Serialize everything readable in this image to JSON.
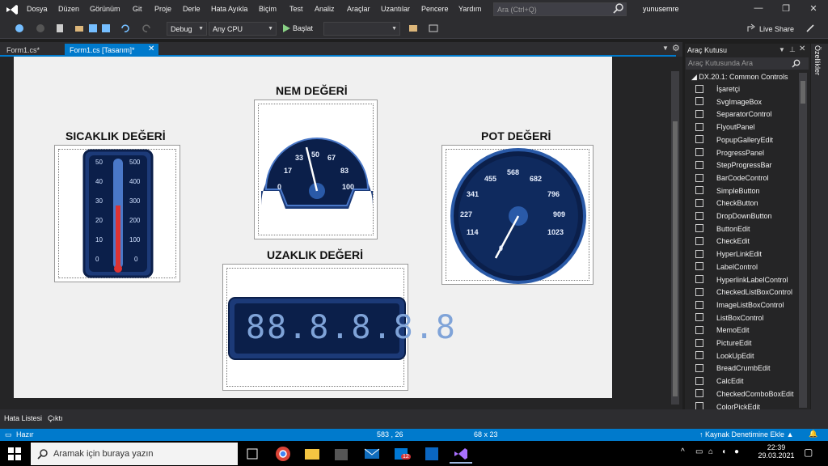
{
  "menu": [
    "Dosya",
    "Düzen",
    "Görünüm",
    "Git",
    "Proje",
    "Derle",
    "Hata Ayıkla",
    "Biçim",
    "Test",
    "Analiz",
    "Araçlar",
    "Uzantılar",
    "Pencere",
    "Yardım"
  ],
  "search": {
    "placeholder": "Ara (Ctrl+Q)"
  },
  "user": "yunusemre",
  "window_controls": {
    "minimize": "—",
    "restore": "❐",
    "close": "✕"
  },
  "toolbar": {
    "config": "Debug",
    "platform": "Any CPU",
    "start": "Başlat",
    "live_share": "Live Share"
  },
  "tabs": [
    {
      "label": "Form1.cs*"
    },
    {
      "label": "Form1.cs [Tasarım]*"
    }
  ],
  "designer": {
    "temp_label": "SICAKLIK DEĞERİ",
    "hum_label": "NEM DEĞERİ",
    "pot_label": "POT DEĞERİ",
    "dist_label": "UZAKLIK DEĞERİ",
    "thermo_left": [
      "50",
      "40",
      "30",
      "20",
      "10",
      "0"
    ],
    "thermo_right": [
      "500",
      "400",
      "300",
      "200",
      "100",
      "0"
    ],
    "hum_ticks": [
      "0",
      "17",
      "33",
      "50",
      "67",
      "83",
      "100"
    ],
    "pot_ticks": [
      "0",
      "114",
      "227",
      "341",
      "455",
      "568",
      "682",
      "796",
      "909",
      "1023"
    ],
    "digits": "88.8.8.8.8"
  },
  "toolbox": {
    "title": "Araç Kutusu",
    "search_placeholder": "Araç Kutusunda Ara",
    "group": "DX.20.1: Common Controls",
    "items": [
      "İşaretçi",
      "SvgImageBox",
      "SeparatorControl",
      "FlyoutPanel",
      "PopupGalleryEdit",
      "ProgressPanel",
      "StepProgressBar",
      "BarCodeControl",
      "SimpleButton",
      "CheckButton",
      "DropDownButton",
      "ButtonEdit",
      "CheckEdit",
      "HyperLinkEdit",
      "LabelControl",
      "HyperlinkLabelControl",
      "CheckedListBoxControl",
      "ImageListBoxControl",
      "ListBoxControl",
      "MemoEdit",
      "PictureEdit",
      "LookUpEdit",
      "BreadCrumbEdit",
      "CalcEdit",
      "CheckedComboBoxEdit",
      "ColorPickEdit"
    ]
  },
  "properties_label": "Özellikler",
  "bottom_tabs": [
    "Hata Listesi",
    "Çıktı"
  ],
  "status": {
    "ready": "Hazır",
    "position": "583 , 26",
    "size": "68 x 23",
    "source_control": "Kaynak Denetimine Ekle"
  },
  "taskbar": {
    "search_placeholder": "Aramak için buraya yazın",
    "time": "22:39",
    "date": "29.03.2021",
    "mail_badge": "12"
  },
  "colors": {
    "accent": "#007acc",
    "gauge_dark": "#0b1f4a",
    "gauge_ring": "#2a5aa8"
  }
}
